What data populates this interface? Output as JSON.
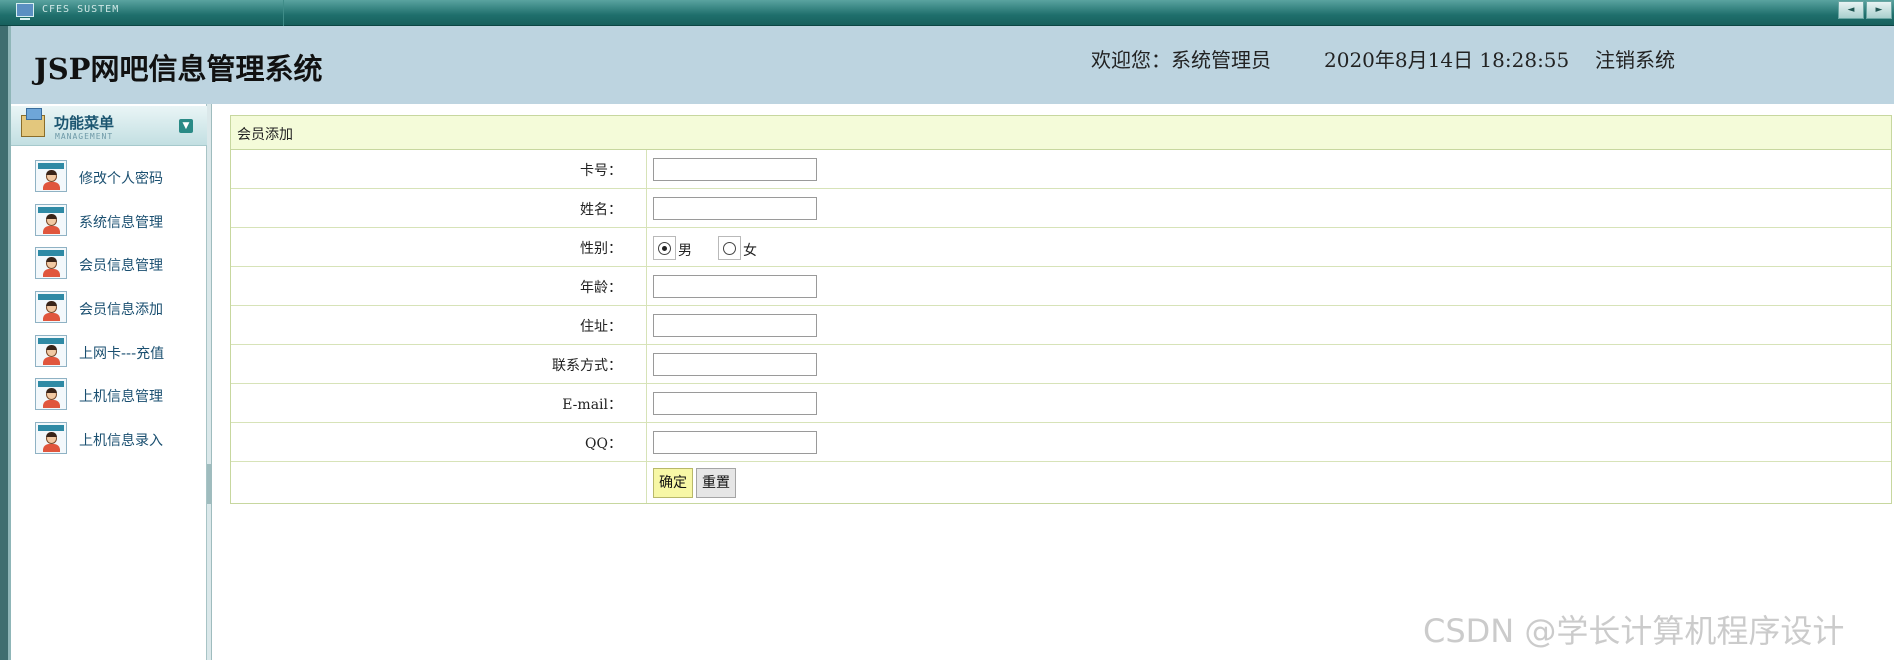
{
  "window": {
    "system_name": "CFES SUSTEM"
  },
  "header": {
    "title": "JSP网吧信息管理系统",
    "welcome": "欢迎您：系统管理员",
    "datetime": "2020年8月14日  18:28:55",
    "logout": "注销系统"
  },
  "sidebar": {
    "menu_title": "功能菜单",
    "menu_subtitle": "MANAGEMENT",
    "items": [
      {
        "label": "修改个人密码",
        "icon": "user-icon"
      },
      {
        "label": "系统信息管理",
        "icon": "user-icon"
      },
      {
        "label": "会员信息管理",
        "icon": "user-icon"
      },
      {
        "label": "会员信息添加",
        "icon": "user-icon"
      },
      {
        "label": "上网卡---充值",
        "icon": "user-icon"
      },
      {
        "label": "上机信息管理",
        "icon": "user-icon"
      },
      {
        "label": "上机信息录入",
        "icon": "user-icon"
      }
    ]
  },
  "form": {
    "title": "会员添加",
    "fields": [
      {
        "label": "卡号：",
        "value": ""
      },
      {
        "label": "姓名：",
        "value": ""
      },
      {
        "label": "性别：",
        "options": [
          "男",
          "女"
        ],
        "selected": "男"
      },
      {
        "label": "年龄：",
        "value": ""
      },
      {
        "label": "住址：",
        "value": ""
      },
      {
        "label": "联系方式：",
        "value": ""
      },
      {
        "label": "E-mail：",
        "value": ""
      },
      {
        "label": "QQ：",
        "value": ""
      }
    ],
    "submit": "确定",
    "reset": "重置"
  },
  "watermark": "CSDN @学长计算机程序设计",
  "colors": {
    "topbar": "#1f6f6c",
    "header_bg": "#bdd4e0",
    "form_header_bg": "#f4fbd9",
    "submit_bg": "#f7f7a6"
  }
}
